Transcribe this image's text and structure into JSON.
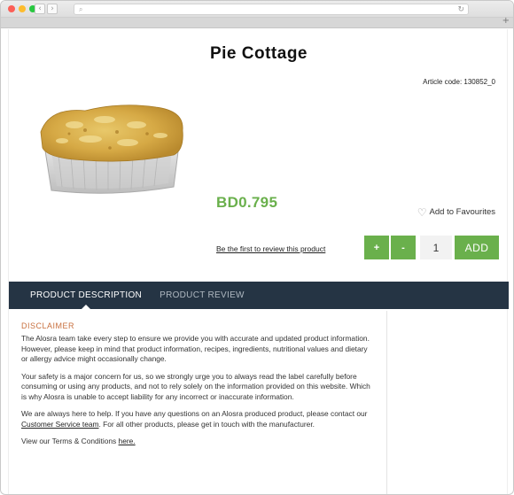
{
  "browser": {
    "back_icon": "‹",
    "forward_icon": "›",
    "reload_icon": "↻",
    "new_tab_icon": "+"
  },
  "product": {
    "title": "Pie Cottage",
    "article_code": "Article code: 130852_0",
    "price": "BD0.795",
    "favourites_label": "Add to Favourites",
    "review_link": "Be the first to review this product",
    "plus_label": "+",
    "minus_label": "-",
    "quantity": "1",
    "add_label": "ADD"
  },
  "tabs": [
    {
      "label": "PRODUCT DESCRIPTION"
    },
    {
      "label": "PRODUCT REVIEW"
    }
  ],
  "disclaimer": {
    "heading": "DISCLAIMER",
    "p1": "The Alosra team take every step to ensure we provide you with accurate and updated product information. However, please keep in mind that product information, recipes, ingredients, nutritional values and dietary or allergy advice might occasionally change.",
    "p2": "Your safety is a major concern for us, so we strongly urge you to always read the label carefully before consuming or using any products, and not to rely solely on the information provided on this website. Which is why Alosra is unable to accept liability for any incorrect or inaccurate information.",
    "p3_before": "We are always here to help. If you have any questions on an Alosra produced product, please contact our ",
    "p3_link": "Customer Service team",
    "p3_after": ". For all other products, please get in touch with the manufacturer.",
    "p4_before": "View our Terms & Conditions ",
    "p4_link": "here."
  },
  "colors": {
    "accent_green": "#6ab04c",
    "tab_bar": "#253444",
    "disclaimer_heading": "#c8703f"
  }
}
